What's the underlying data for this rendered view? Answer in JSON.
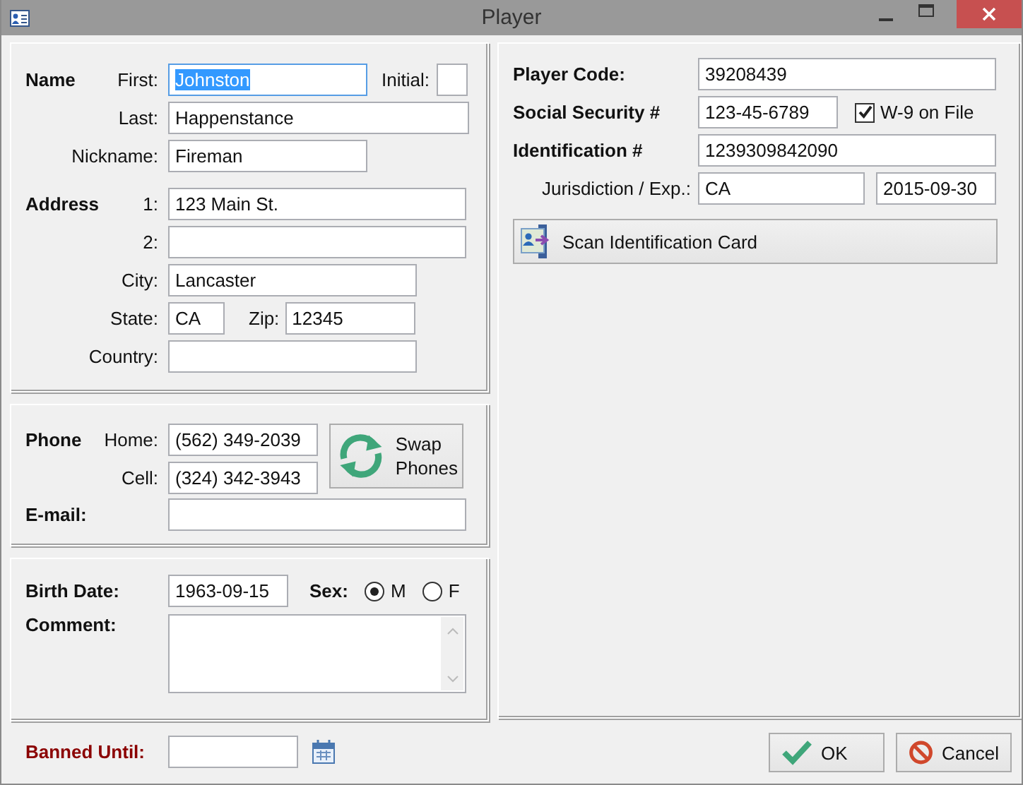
{
  "window": {
    "title": "Player"
  },
  "name": {
    "heading": "Name",
    "first_label": "First:",
    "first": {
      "value": "Johnston",
      "focused": true
    },
    "initial_label": "Initial:",
    "last_label": "Last:",
    "last": "Happenstance",
    "nickname_label": "Nickname:",
    "nickname": "Fireman"
  },
  "address": {
    "heading": "Address",
    "line1_label": "1:",
    "line1": "123 Main St.",
    "line2_label": "2:",
    "city_label": "City:",
    "city": "Lancaster",
    "state_label": "State:",
    "state": "CA",
    "zip_label": "Zip:",
    "zip": "12345",
    "country_label": "Country:"
  },
  "phone": {
    "heading": "Phone",
    "home_label": "Home:",
    "home": "(562) 349-2039",
    "cell_label": "Cell:",
    "cell": "(324) 342-3943",
    "swap_button": "Swap Phones",
    "email_label": "E-mail:"
  },
  "details": {
    "birth_label": "Birth Date:",
    "birth": "1963-09-15",
    "sex_label": "Sex:",
    "sex_options": [
      {
        "label": "M",
        "selected": true
      },
      {
        "label": "F",
        "selected": false
      }
    ],
    "comment_label": "Comment:"
  },
  "banned": {
    "label": "Banned Until:"
  },
  "player": {
    "code_label": "Player Code:",
    "code": "39208439",
    "ssn_label": "Social Security #",
    "ssn": "123-45-6789",
    "w9": {
      "label": "W-9 on File",
      "checked": true
    },
    "id_label": "Identification #",
    "id": "1239309842090",
    "jurisdiction_label": "Jurisdiction / Exp.:",
    "jurisdiction": "CA",
    "expiry": "2015-09-30",
    "scan_button": "Scan Identification Card"
  },
  "buttons": {
    "ok": "OK",
    "cancel": "Cancel"
  }
}
